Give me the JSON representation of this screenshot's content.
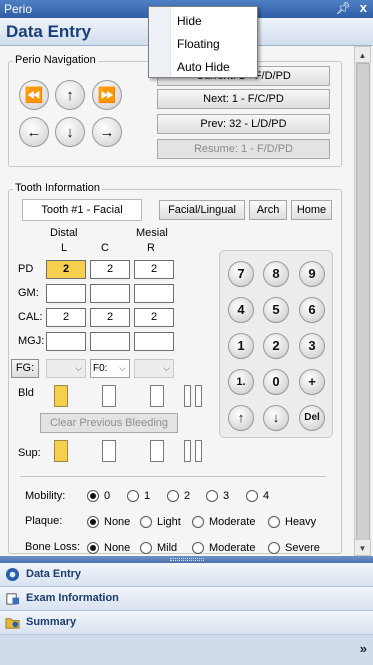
{
  "window": {
    "title": "Perio",
    "pin_icon": "pin-icon",
    "close_glyph": "x"
  },
  "header": {
    "title": "Data Entry"
  },
  "context_menu": {
    "items": [
      "Hide",
      "Floating",
      "Auto Hide"
    ]
  },
  "perio_nav": {
    "legend": "Perio Navigation",
    "arrows": {
      "first": "⏪",
      "up": "↑",
      "last": "⏩",
      "left": "←",
      "down": "↓",
      "right": "→"
    },
    "current": "Current:   1 - F/D/PD",
    "next": "Next:    1 - F/C/PD",
    "prev": "Prev:    32 - L/D/PD",
    "resume": "Resume:  1 - F/D/PD"
  },
  "tooth_info": {
    "legend": "Tooth Information",
    "tooth": "Tooth #1 - Facial",
    "facial_lingual": "Facial/Lingual",
    "arch": "Arch",
    "home": "Home",
    "col_top": {
      "distal": "Distal",
      "mesial": "Mesial"
    },
    "cols": [
      "L",
      "C",
      "R"
    ],
    "rows": {
      "pd": {
        "label": "PD",
        "values": [
          "2",
          "2",
          "2"
        ]
      },
      "gm": {
        "label": "GM:",
        "values": [
          "",
          "",
          ""
        ]
      },
      "cal": {
        "label": "CAL:",
        "values": [
          "2",
          "2",
          "2"
        ]
      },
      "mgj": {
        "label": "MGJ:",
        "values": [
          "",
          "",
          ""
        ]
      }
    },
    "fg": {
      "label": "FG:",
      "selected": [
        "",
        "F0:",
        ""
      ]
    },
    "bld_label": "Bld",
    "clear_bleeding": "Clear Previous Bleeding",
    "sup_label": "Sup:",
    "bleeding": [
      true,
      false,
      false
    ],
    "suppuration": [
      true,
      false,
      false
    ]
  },
  "keypad": {
    "keys": [
      "7",
      "8",
      "9",
      "4",
      "5",
      "6",
      "1",
      "2",
      "3",
      "1.",
      "0",
      "+",
      "↑",
      "↓",
      "Del"
    ]
  },
  "options": {
    "mobility": {
      "label": "Mobility:",
      "options": [
        "0",
        "1",
        "2",
        "3",
        "4"
      ],
      "selected": 0
    },
    "plaque": {
      "label": "Plaque:",
      "options": [
        "None",
        "Light",
        "Moderate",
        "Heavy"
      ],
      "selected": 0
    },
    "bone_loss": {
      "label": "Bone Loss:",
      "options": [
        "None",
        "Mild",
        "Moderate",
        "Severe"
      ],
      "selected": 0
    }
  },
  "panels": [
    {
      "label": "Data Entry",
      "icon": "data-entry-icon"
    },
    {
      "label": "Exam Information",
      "icon": "exam-information-icon"
    },
    {
      "label": "Summary",
      "icon": "summary-icon"
    }
  ],
  "footer": {
    "chevron": "»"
  },
  "colors": {
    "title_blue": "#2f5ea5",
    "header_text": "#1a3f7a",
    "highlight": "#f7cf4f"
  }
}
